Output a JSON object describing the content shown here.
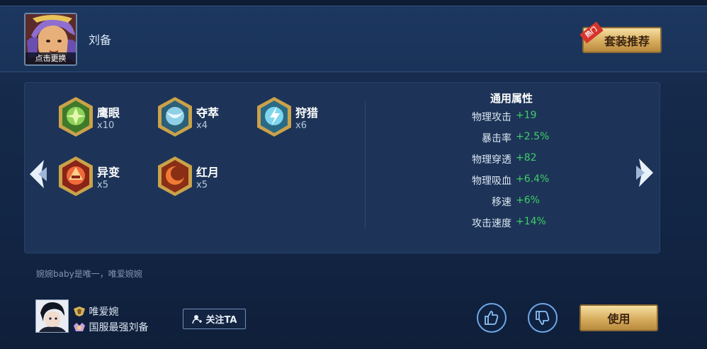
{
  "hero": {
    "avatar_caption": "点击更换",
    "name": "刘备"
  },
  "recommend": {
    "label": "套装推荐",
    "hot_tag": "热门"
  },
  "runes": [
    {
      "name": "鹰眼",
      "count": "x10",
      "icon": "eagle-eye-rune-icon",
      "color": "#5fa83a"
    },
    {
      "name": "夺萃",
      "count": "x4",
      "icon": "plunder-rune-icon",
      "color": "#5aa8c8"
    },
    {
      "name": "狩猎",
      "count": "x6",
      "icon": "hunt-rune-icon",
      "color": "#4fb8d8"
    },
    {
      "name": "异变",
      "count": "x5",
      "icon": "mutation-rune-icon",
      "color": "#d8452c"
    },
    {
      "name": "红月",
      "count": "x5",
      "icon": "red-moon-rune-icon",
      "color": "#d8572c"
    }
  ],
  "attributes": {
    "title": "通用属性",
    "items": [
      {
        "name": "物理攻击",
        "value": "+19"
      },
      {
        "name": "暴击率",
        "value": "+2.5%"
      },
      {
        "name": "物理穿透",
        "value": "+82"
      },
      {
        "name": "物理吸血",
        "value": "+6.4%"
      },
      {
        "name": "移速",
        "value": "+6%"
      },
      {
        "name": "攻击速度",
        "value": "+14%"
      }
    ]
  },
  "comment": "婉婉baby是唯一，唯爱婉婉",
  "author": {
    "name": "唯爱婉",
    "title": "国服最强刘备"
  },
  "follow": {
    "label": "关注TA"
  },
  "use_button": {
    "label": "使用"
  },
  "colors": {
    "value_green": "#3ecf66",
    "gold_button": "#d7ad5e",
    "panel": "#1d3458"
  }
}
